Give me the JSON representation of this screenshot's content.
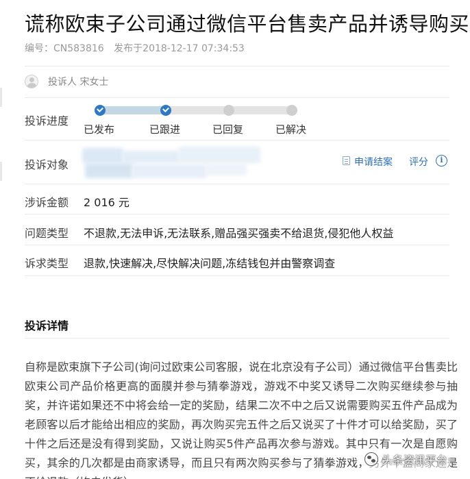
{
  "header": {
    "title": "谎称欧束子公司通过微信平台售卖产品并诱导购买",
    "id_text": "编号：CN583816",
    "published_text": "发布于2018-12-17 07:34:53"
  },
  "complainant": {
    "text": "投诉人 宋女士"
  },
  "progress": {
    "label": "投诉进度",
    "completed_steps": 2,
    "steps": [
      {
        "label": "已发布",
        "done": true
      },
      {
        "label": "已跟进",
        "done": true
      },
      {
        "label": "已回复",
        "done": false
      },
      {
        "label": "已解决",
        "done": false
      }
    ]
  },
  "target": {
    "label": "投诉对象",
    "apply_close_label": "申请结案",
    "rate_label": "评分"
  },
  "amount": {
    "label": "涉诉金额",
    "value": "2 016 元"
  },
  "problem_type": {
    "label": "问题类型",
    "value": "不退款,无法申诉,无法联系,赠品强买强卖不给退货,侵犯他人权益"
  },
  "demand_type": {
    "label": "诉求类型",
    "value": "退款,快速解决,尽快解决问题,冻结钱包并由警察调查"
  },
  "details": {
    "title": "投诉详情",
    "text": "自称是欧束旗下子公司(询问过欧束公司客服，说在北京没有子公司）通过微信平台售卖比欧束公司产品价格更高的面膜并参与猜拳游戏，游戏不中奖又诱导二次购买继续参与抽奖，并许诺如果还不中将会给一定的奖励，结果二次不中之后又说需要购买五件产品成为老顾客以后才能给出相应的奖励，再次购买完五件之后又说买了十件才可以给奖励，买了十件之后还是没有得到奖励，又说让购买5件产品再次参与游戏。其中只有一次是自愿购买，其余的几次都是由商家诱导，而且只有两次购买参与了猜拳游戏，另外十盒商家还是不给退款（均未发货）"
  },
  "watermark": {
    "text": "头条资讯平台"
  },
  "colors": {
    "accent": "#2f79c4",
    "link": "#2e6fb4",
    "progress_done": "#c4d7e5",
    "progress_todo": "#e3e3e3"
  }
}
